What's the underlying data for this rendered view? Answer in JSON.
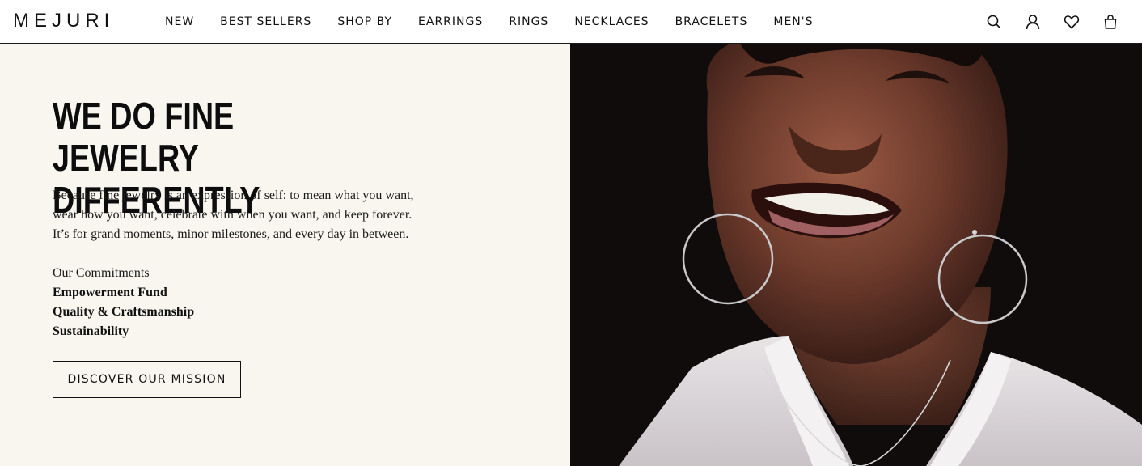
{
  "brand": {
    "logo_text": "MEJURI"
  },
  "nav": {
    "items": [
      "NEW",
      "BEST SELLERS",
      "SHOP BY",
      "EARRINGS",
      "RINGS",
      "NECKLACES",
      "BRACELETS",
      "MEN'S"
    ]
  },
  "header_icons": [
    "search-icon",
    "account-icon",
    "wishlist-heart-icon",
    "shopping-bag-icon"
  ],
  "hero": {
    "title_line1": "WE DO FINE JEWELRY",
    "title_line2": "DIFFERENTLY",
    "body": "Because fine jewelry is an expression of self: to mean what you want, wear how you want, celebrate with when you want, and keep forever. It’s for grand moments, minor milestones, and every day in between.",
    "commitments_heading": "Our Commitments",
    "commitments": [
      "Empowerment Fund",
      "Quality & Craftsmanship",
      "Sustainability"
    ],
    "cta_label": "DISCOVER OUR MISSION"
  },
  "colors": {
    "panel_bg": "#f9f6ef",
    "text": "#111111",
    "image_bg": "#0f0c0b"
  }
}
